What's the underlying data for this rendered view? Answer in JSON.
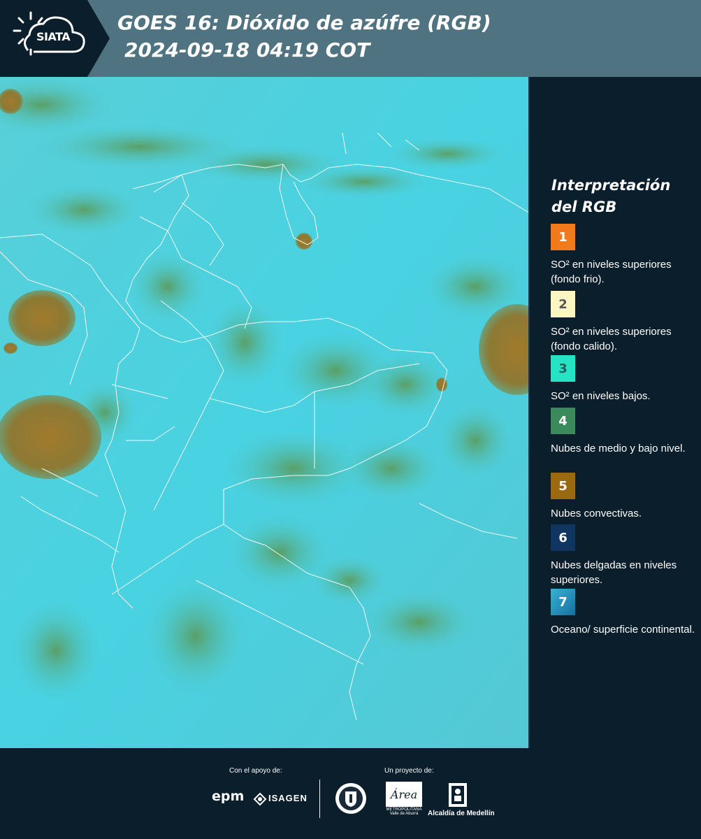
{
  "header": {
    "logo_text": "SIATA",
    "title_line1": "GOES 16: Dióxido de azúfre (RGB)",
    "title_line2": "2024-09-18 04:19 COT"
  },
  "legend": {
    "title_line1": "Interpretación",
    "title_line2": "del RGB",
    "items": [
      {
        "number": "1",
        "label": "SO² en niveles superiores (fondo frio).",
        "color": "#f27a1a",
        "text_color": "#ffffff"
      },
      {
        "number": "2",
        "label": "SO² en niveles superiores (fondo calido).",
        "color": "#fbf6c4",
        "text_color": "#555555"
      },
      {
        "number": "3",
        "label": "SO² en niveles bajos.",
        "color": "#25e3c4",
        "text_color": "#2a5c58"
      },
      {
        "number": "4",
        "label": "Nubes de medio y bajo nivel.",
        "color": "#3a8a5c",
        "text_color": "#ffffff"
      },
      {
        "number": "5",
        "label": "Nubes convectivas.",
        "color": "#9b6a10",
        "text_color": "#ffffff"
      },
      {
        "number": "6",
        "label": "Nubes delgadas en niveles superiores.",
        "color": "#0f3560",
        "text_color": "#ffffff"
      },
      {
        "number": "7",
        "label": "Oceano/ superficie continental.",
        "color": "#1d93c4",
        "text_color": "#ffffff"
      }
    ]
  },
  "footer": {
    "support_label": "Con el apoyo de:",
    "project_label": "Un proyecto de:",
    "epm": "epm",
    "isagen": "ISAGEN",
    "area_text": "Área",
    "area_sub": "METROPOLITANA Valle de Aburrá",
    "alcaldia": "Alcaldía de Medellín"
  },
  "colors": {
    "header_bg": "#4f7381",
    "panel_bg": "#0b1e2c",
    "ocean": "#4fd3e0",
    "cloud_green": "#5fa76a",
    "convective": "#a57c2a"
  }
}
